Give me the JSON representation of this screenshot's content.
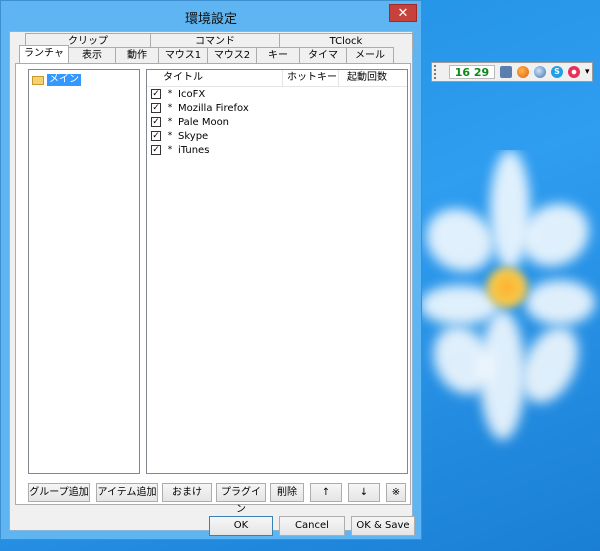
{
  "window": {
    "title": "環境設定",
    "close_symbol": "✕"
  },
  "tabs": {
    "row1": [
      "クリップ",
      "コマンド",
      "TClock"
    ],
    "row2": [
      "ランチャ",
      "表示",
      "動作",
      "マウス1",
      "マウス2",
      "キー",
      "タイマ",
      "メール"
    ],
    "active": "ランチャ"
  },
  "tree": {
    "items": [
      {
        "label": "メイン",
        "selected": true,
        "icon": "folder-icon"
      }
    ]
  },
  "list": {
    "columns": [
      "タイトル",
      "ホットキー",
      "起動回数"
    ],
    "rows": [
      {
        "title": "IcoFX",
        "checked": true,
        "marker": "*"
      },
      {
        "title": "Mozilla Firefox",
        "checked": true,
        "marker": "*"
      },
      {
        "title": "Pale Moon",
        "checked": true,
        "marker": "*"
      },
      {
        "title": "Skype",
        "checked": true,
        "marker": "*"
      },
      {
        "title": "iTunes",
        "checked": true,
        "marker": "*"
      }
    ]
  },
  "buttons": {
    "add_group": "グループ追加",
    "add_item": "アイテム追加",
    "extra": "おまけ",
    "plugin": "プラグイン",
    "delete": "削除",
    "up": "↑",
    "down": "↓",
    "note": "※"
  },
  "footer": {
    "ok": "OK",
    "cancel": "Cancel",
    "ok_save": "OK & Save"
  },
  "tray": {
    "time": "16 29",
    "icons": [
      "monitor-icon",
      "firefox-icon",
      "palemoon-icon",
      "skype-icon",
      "itunes-icon",
      "dropdown-arrow-icon"
    ],
    "dropdown_symbol": "▾"
  },
  "colors": {
    "desktop_blue": "#2f9df0",
    "window_frame": "#5fb4f2",
    "close_red": "#c7423c",
    "selection_blue": "#3399ff",
    "clock_green": "#0a8a18"
  }
}
